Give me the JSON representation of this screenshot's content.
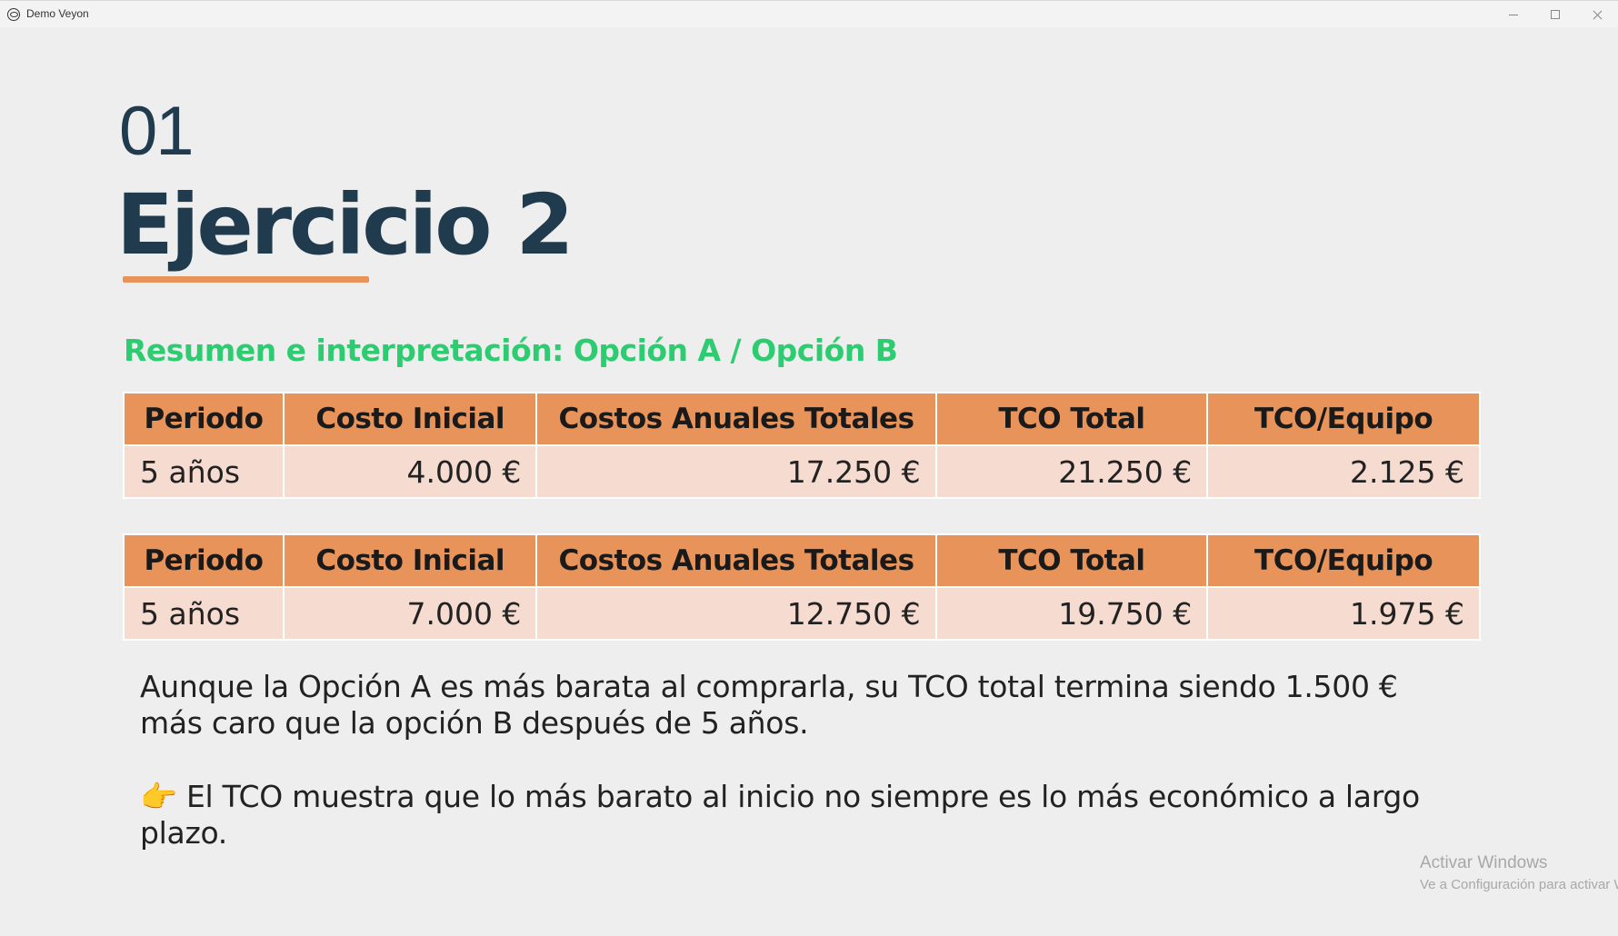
{
  "window": {
    "title": "Demo Veyon",
    "icon": "veyon-eye-icon"
  },
  "slide": {
    "number": "01",
    "title": "Ejercicio 2",
    "subtitle": "Resumen e interpretación: Opción A / Opción B",
    "accent_color": "#e8935a",
    "subtitle_color": "#2ecc71",
    "title_color": "#1f3b4d"
  },
  "tables": [
    {
      "headers": [
        "Periodo",
        "Costo Inicial",
        "Costos Anuales Totales",
        "TCO Total",
        "TCO/Equipo"
      ],
      "row": [
        "5 años",
        "4.000 €",
        "17.250 €",
        "21.250 €",
        "2.125 €"
      ]
    },
    {
      "headers": [
        "Periodo",
        "Costo Inicial",
        "Costos Anuales Totales",
        "TCO Total",
        "TCO/Equipo"
      ],
      "row": [
        "5 años",
        "7.000 €",
        "12.750 €",
        "19.750 €",
        "1.975 €"
      ]
    }
  ],
  "paragraphs": {
    "p1": "Aunque la Opción A es más barata al comprarla, su TCO total termina siendo 1.500 € más caro que la opción B después de 5 años.",
    "p2_icon": "👉",
    "p2": "El TCO muestra que lo más barato al inicio no siempre es lo más económico a largo plazo."
  },
  "watermark": {
    "line1": "Activar Windows",
    "line2": "Ve a Configuración para activar W"
  }
}
